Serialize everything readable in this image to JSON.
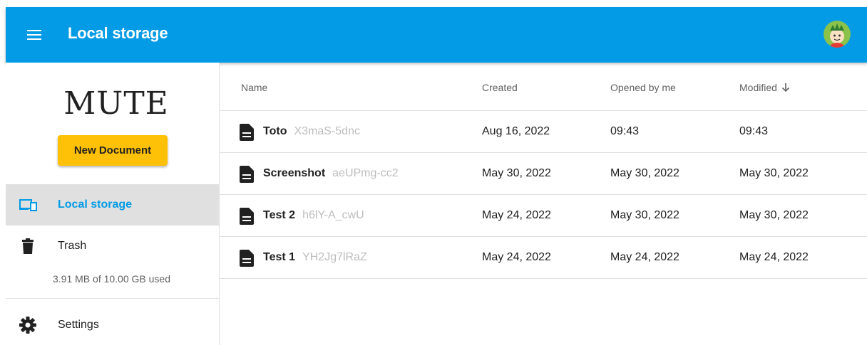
{
  "appbar": {
    "title": "Local storage",
    "accent": "#039be5"
  },
  "sidebar": {
    "logo_text": "MUTE",
    "new_document_label": "New Document",
    "items": [
      {
        "label": "Local storage",
        "icon": "devices-icon",
        "active": true
      },
      {
        "label": "Trash",
        "icon": "trash-icon",
        "active": false
      }
    ],
    "storage_info": "3.91 MB of 10.00 GB used",
    "settings_label": "Settings"
  },
  "table": {
    "columns": [
      "Name",
      "Created",
      "Opened by me",
      "Modified"
    ],
    "sorted_column": "Modified",
    "rows": [
      {
        "title": "Toto",
        "key": "X3maS-5dnc",
        "created": "Aug 16, 2022",
        "opened": "09:43",
        "modified": "09:43"
      },
      {
        "title": "Screenshot",
        "key": "aeUPmg-cc2",
        "created": "May 30, 2022",
        "opened": "May 30, 2022",
        "modified": "May 30, 2022"
      },
      {
        "title": "Test 2",
        "key": "h6lY-A_cwU",
        "created": "May 24, 2022",
        "opened": "May 30, 2022",
        "modified": "May 30, 2022"
      },
      {
        "title": "Test 1",
        "key": "YH2Jg7lRaZ",
        "created": "May 24, 2022",
        "opened": "May 24, 2022",
        "modified": "May 24, 2022"
      }
    ]
  },
  "colors": {
    "primary": "#039be5",
    "accent_button": "#ffc107",
    "active_bg": "#e0e0e0"
  }
}
